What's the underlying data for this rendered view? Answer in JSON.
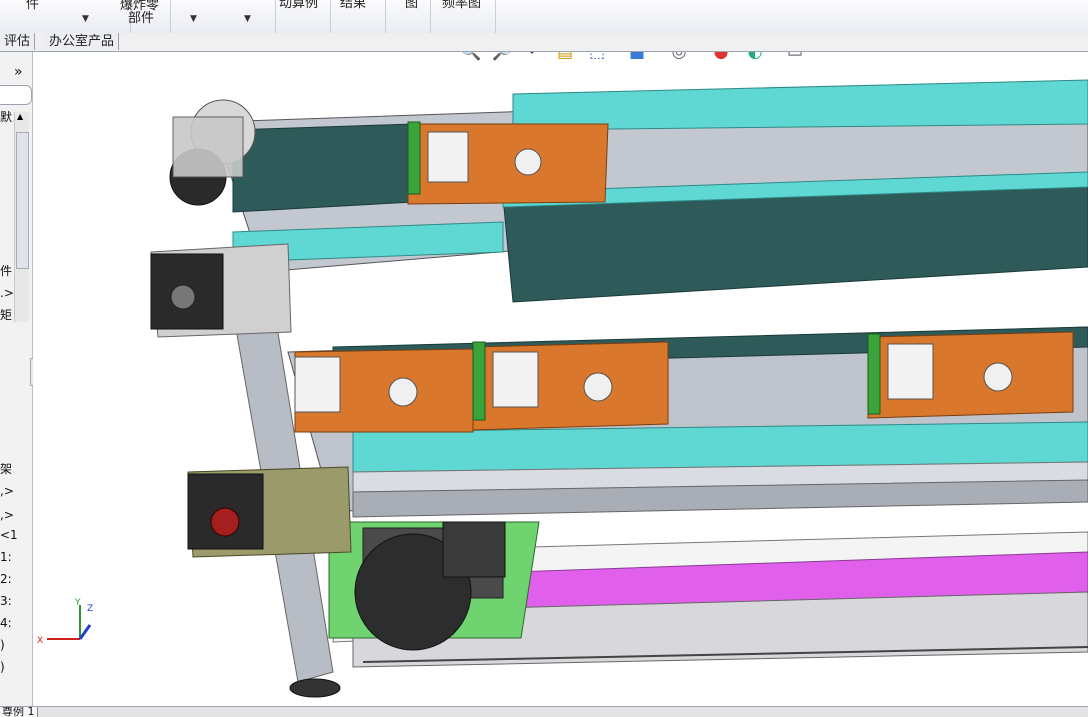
{
  "ribbon": {
    "groups": [
      {
        "label": "件"
      },
      {
        "label": "爆炸零",
        "label2": "部件"
      },
      {
        "label": ""
      },
      {
        "label": "动算例"
      },
      {
        "label": "结果"
      },
      {
        "label": "图"
      },
      {
        "label": "频率图"
      }
    ]
  },
  "doc_tabs": [
    "评估",
    "办公室产品"
  ],
  "side_panel": {
    "collapse_glyph": "»",
    "items": [
      "默",
      "件",
      ".>",
      "矩",
      "架",
      ",>",
      ",>",
      "<1",
      "1:",
      "2:",
      "3:",
      "4:",
      ")",
      ")"
    ]
  },
  "hud_icons": [
    {
      "name": "zoom-to-fit-icon",
      "glyph": "🔍"
    },
    {
      "name": "zoom-area-icon",
      "glyph": "🔎"
    },
    {
      "name": "previous-view-icon",
      "glyph": "↶"
    },
    {
      "name": "section-view-icon",
      "glyph": "▤"
    },
    {
      "name": "view-orientation-icon",
      "glyph": "⬚"
    },
    {
      "name": "display-style-icon",
      "glyph": "■"
    },
    {
      "name": "hide-show-items-icon",
      "glyph": "◎"
    },
    {
      "name": "edit-appearance-icon",
      "glyph": "●"
    },
    {
      "name": "apply-scene-icon",
      "glyph": "◐"
    },
    {
      "name": "view-settings-icon",
      "glyph": "▭"
    }
  ],
  "triad": {
    "x": "X",
    "y": "Y",
    "z": "Z"
  },
  "status_bar": {
    "tab": "尊例 1"
  },
  "colors": {
    "teal": "#5fd8d4",
    "dark_teal": "#2e5b5a",
    "orange_plate": "#d9782c",
    "magenta": "#e060ec",
    "green_base": "#6fd36f",
    "frame_gray": "#b8bcc4"
  }
}
